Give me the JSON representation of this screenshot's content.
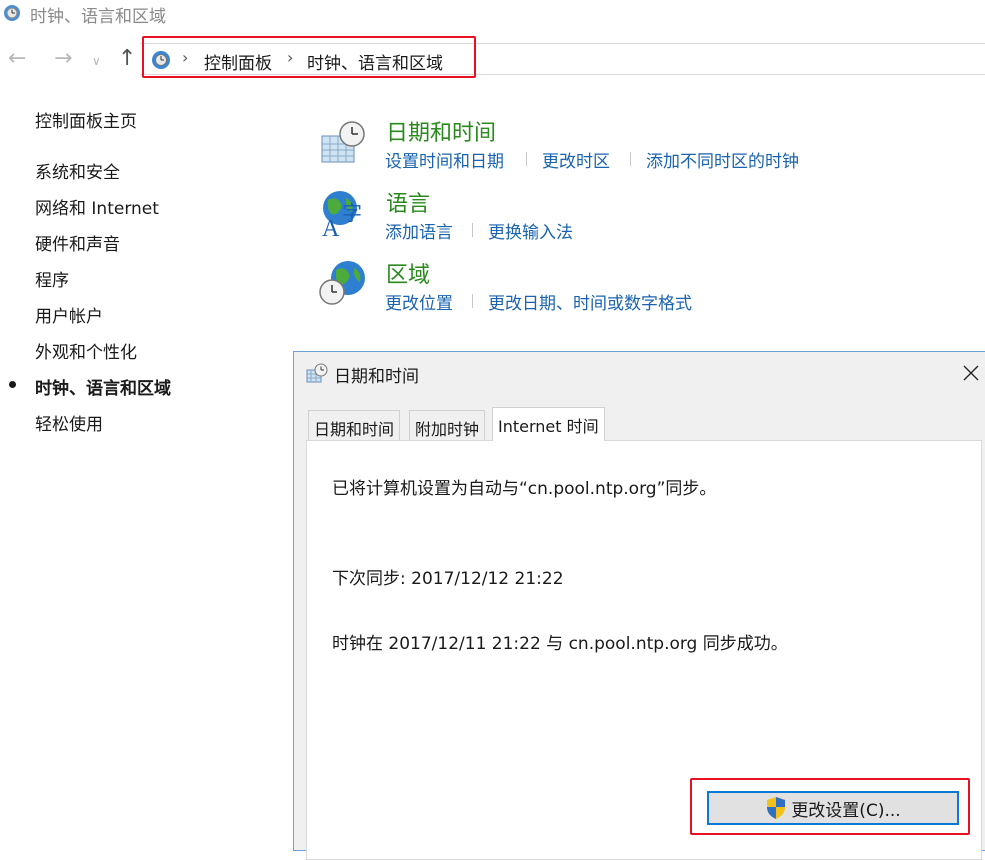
{
  "window": {
    "title": "时钟、语言和区域"
  },
  "address": {
    "root": "控制面板",
    "current": "时钟、语言和区域"
  },
  "sidebar": {
    "home": "控制面板主页",
    "items": [
      {
        "label": "系统和安全"
      },
      {
        "label": "网络和 Internet"
      },
      {
        "label": "硬件和声音"
      },
      {
        "label": "程序"
      },
      {
        "label": "用户帐户"
      },
      {
        "label": "外观和个性化"
      },
      {
        "label": "时钟、语言和区域",
        "active": true
      },
      {
        "label": "轻松使用"
      }
    ]
  },
  "categories": [
    {
      "title": "日期和时间",
      "icon": "clock-calendar-icon",
      "links": [
        "设置时间和日期",
        "更改时区",
        "添加不同时区的时钟"
      ]
    },
    {
      "title": "语言",
      "icon": "globe-language-icon",
      "links": [
        "添加语言",
        "更换输入法"
      ]
    },
    {
      "title": "区域",
      "icon": "globe-clock-icon",
      "links": [
        "更改位置",
        "更改日期、时间或数字格式"
      ]
    }
  ],
  "dialog": {
    "title": "日期和时间",
    "tabs": [
      "日期和时间",
      "附加时钟",
      "Internet 时间"
    ],
    "selected_tab": "Internet 时间",
    "line1": "已将计算机设置为自动与“cn.pool.ntp.org”同步。",
    "line2": "下次同步: 2017/12/12 21:22",
    "line3": "时钟在 2017/12/11 21:22 与 cn.pool.ntp.org 同步成功。",
    "button": "更改设置(C)..."
  },
  "colors": {
    "accent_green": "#2a8a1e",
    "link_blue": "#1a63b0",
    "highlight_red": "#e81123",
    "button_border": "#0a78d7"
  }
}
